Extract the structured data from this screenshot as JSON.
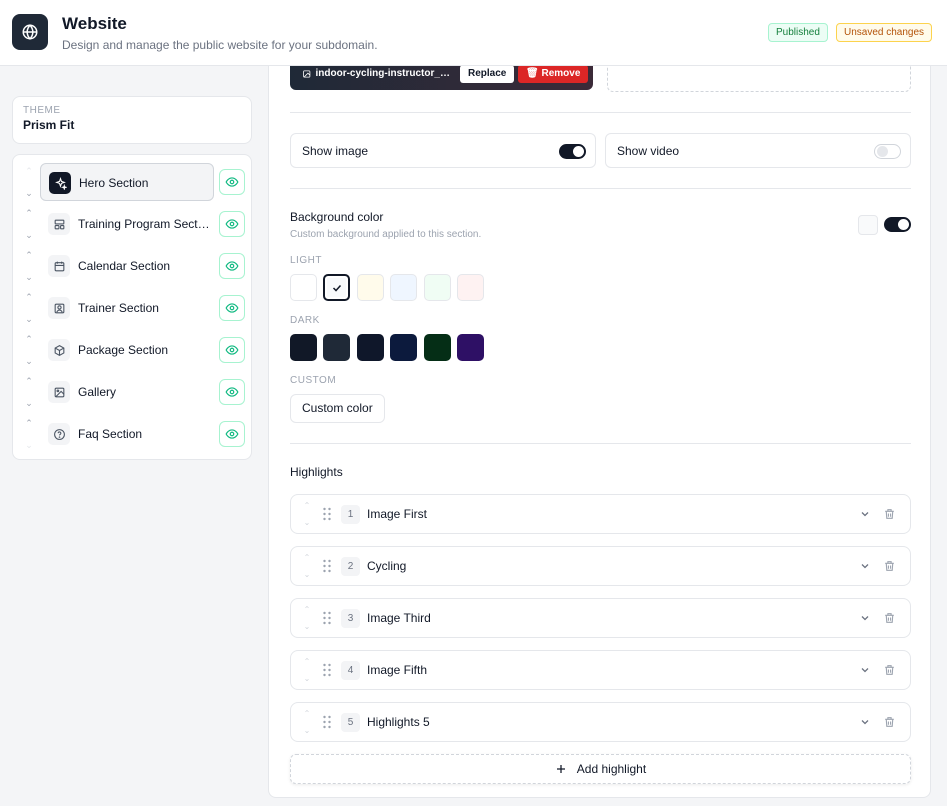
{
  "header": {
    "title": "Website",
    "subtitle": "Design and manage the public website for your subdomain.",
    "badge_published": "Published",
    "badge_unsaved": "Unsaved changes",
    "icon": "globe-icon"
  },
  "sidebar": {
    "theme_label": "THEME",
    "theme_name": "Prism Fit",
    "sections": [
      {
        "label": "Hero Section",
        "icon": "sparkles-icon",
        "active": true,
        "visible": true
      },
      {
        "label": "Training Program Secti...",
        "icon": "layout-icon",
        "active": false,
        "visible": true
      },
      {
        "label": "Calendar Section",
        "icon": "calendar-icon",
        "active": false,
        "visible": true
      },
      {
        "label": "Trainer Section",
        "icon": "user-square-icon",
        "active": false,
        "visible": true
      },
      {
        "label": "Package Section",
        "icon": "package-icon",
        "active": false,
        "visible": true
      },
      {
        "label": "Gallery",
        "icon": "image-icon",
        "active": false,
        "visible": true
      },
      {
        "label": "Faq Section",
        "icon": "help-circle-icon",
        "active": false,
        "visible": true
      }
    ]
  },
  "media": {
    "image_filename": "indoor-cycling-instructor_4c...",
    "replace_label": "Replace",
    "remove_label": "Remove"
  },
  "toggles": {
    "show_image_label": "Show image",
    "show_image_on": true,
    "show_video_label": "Show video",
    "show_video_on": false
  },
  "background": {
    "title": "Background color",
    "description": "Custom background applied to this section.",
    "enabled": true,
    "light_label": "LIGHT",
    "dark_label": "DARK",
    "custom_label": "CUSTOM",
    "custom_button": "Custom color",
    "light_swatches": [
      "#ffffff",
      "#f8fafc",
      "#fffbeb",
      "#eff6ff",
      "#f0fdf4",
      "#fef2f2"
    ],
    "selected_light_index": 1,
    "dark_swatches": [
      "#111827",
      "#1f2937",
      "#0f172a",
      "#0c1a3d",
      "#052e16",
      "#2e1065"
    ]
  },
  "highlights": {
    "title": "Highlights",
    "items": [
      {
        "num": "1",
        "label": "Image First"
      },
      {
        "num": "2",
        "label": "Cycling"
      },
      {
        "num": "3",
        "label": "Image Third"
      },
      {
        "num": "4",
        "label": "Image Fifth"
      },
      {
        "num": "5",
        "label": "Highlights 5"
      }
    ],
    "add_label": "Add highlight"
  }
}
